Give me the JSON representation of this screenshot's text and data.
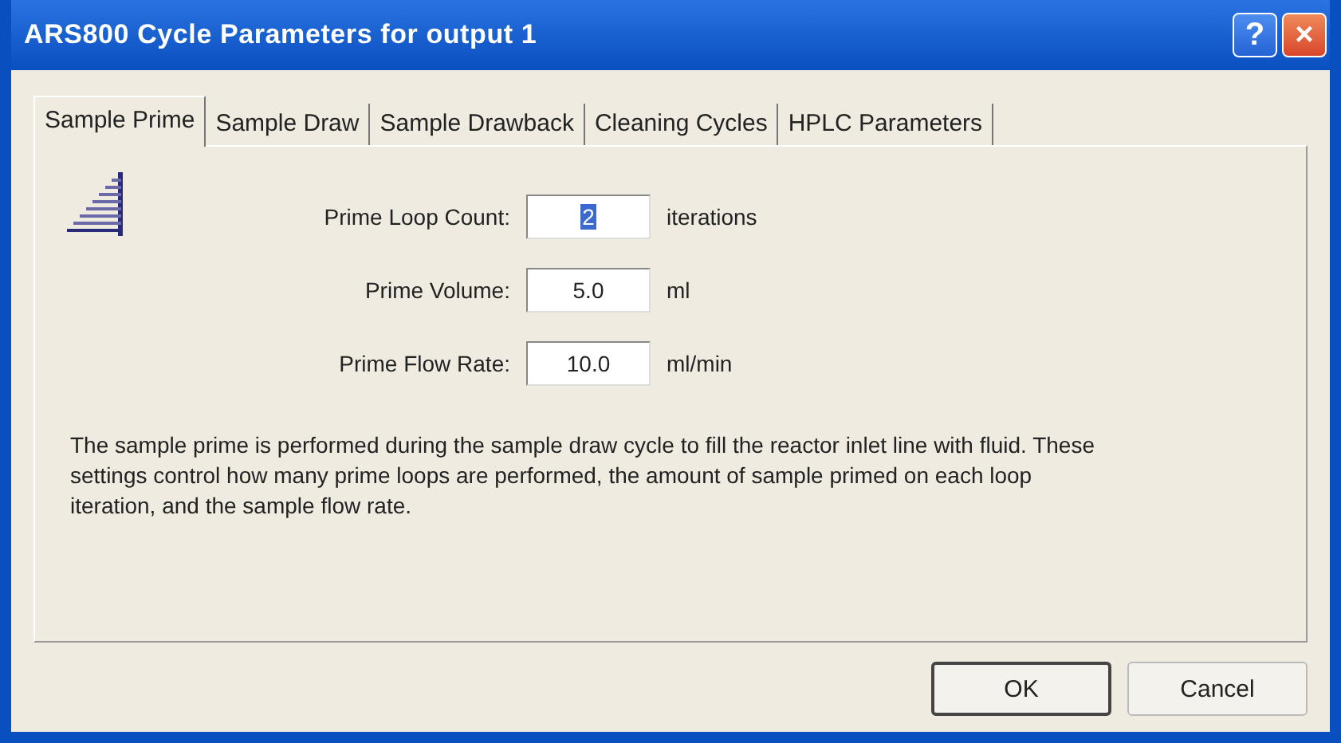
{
  "window": {
    "title": "ARS800 Cycle Parameters for output 1",
    "help": "?",
    "close": "×"
  },
  "tabs": [
    {
      "label": "Sample Prime",
      "selected": true
    },
    {
      "label": "Sample Draw",
      "selected": false
    },
    {
      "label": "Sample Drawback",
      "selected": false
    },
    {
      "label": "Cleaning Cycles",
      "selected": false
    },
    {
      "label": "HPLC Parameters",
      "selected": false
    }
  ],
  "fields": [
    {
      "label": "Prime Loop Count:",
      "value": "2",
      "unit": "iterations",
      "highlighted": true
    },
    {
      "label": "Prime Volume:",
      "value": "5.0",
      "unit": "ml",
      "highlighted": false
    },
    {
      "label": "Prime Flow Rate:",
      "value": "10.0",
      "unit": "ml/min",
      "highlighted": false
    }
  ],
  "description": "The sample prime is performed during the sample draw cycle to fill the reactor inlet line with fluid.  These settings control how many prime loops are performed, the amount of sample primed on each loop iteration, and the sample flow rate.",
  "buttons": [
    {
      "label": "OK",
      "default": true
    },
    {
      "label": "Cancel",
      "default": false
    }
  ]
}
